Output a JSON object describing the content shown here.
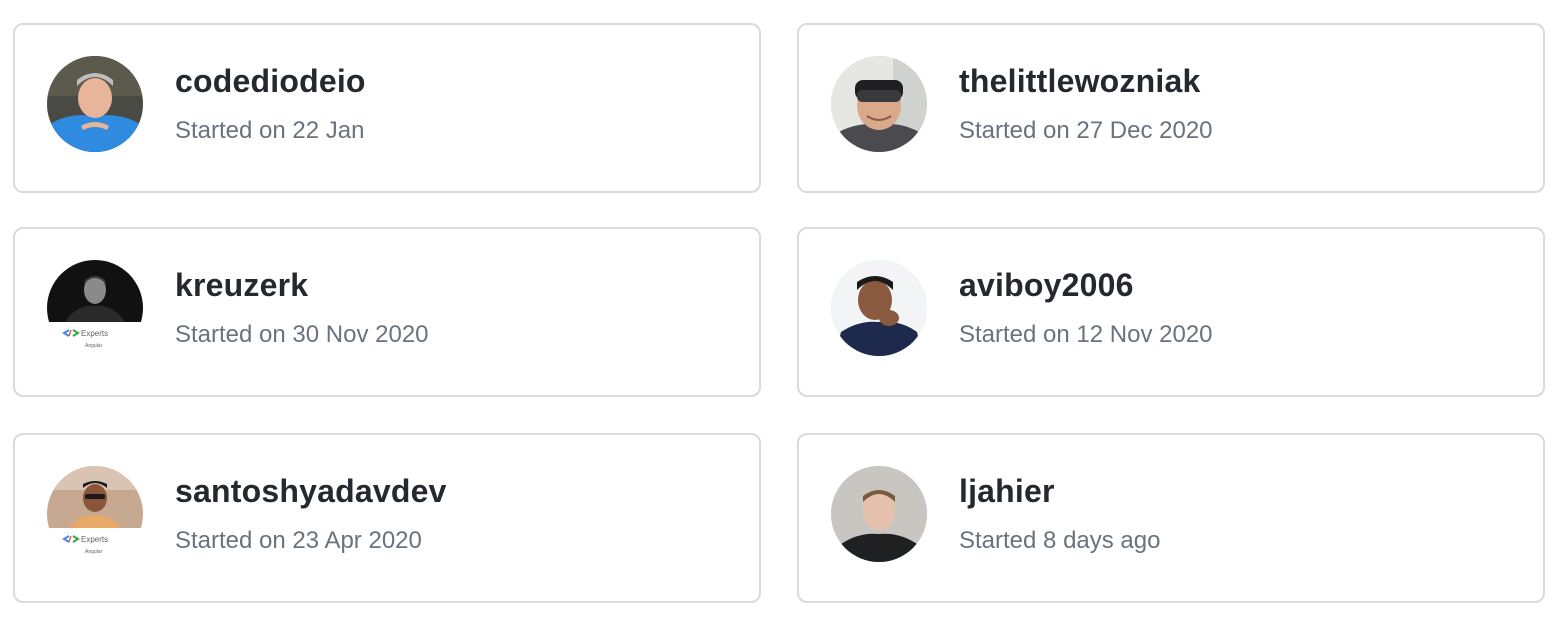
{
  "users": [
    {
      "username": "codediodeio",
      "started": "Started on 22 Jan",
      "avatar_icon": "user-avatar-icon",
      "badge": ""
    },
    {
      "username": "thelittlewozniak",
      "started": "Started on 27 Dec 2020",
      "avatar_icon": "user-avatar-icon",
      "badge": ""
    },
    {
      "username": "kreuzerk",
      "started": "Started on 30 Nov 2020",
      "avatar_icon": "user-avatar-icon",
      "badge": "Experts",
      "badge_sub": "Angular"
    },
    {
      "username": "aviboy2006",
      "started": "Started on 12 Nov 2020",
      "avatar_icon": "user-avatar-icon",
      "badge": ""
    },
    {
      "username": "santoshyadavdev",
      "started": "Started on 23 Apr 2020",
      "avatar_icon": "user-avatar-icon",
      "badge": "Experts",
      "badge_sub": "Angular"
    },
    {
      "username": "ljahier",
      "started": "Started 8 days ago",
      "avatar_icon": "user-avatar-icon",
      "badge": ""
    }
  ],
  "colors": {
    "border": "#d8dadd",
    "username": "#24292f",
    "meta": "#6a737d"
  }
}
